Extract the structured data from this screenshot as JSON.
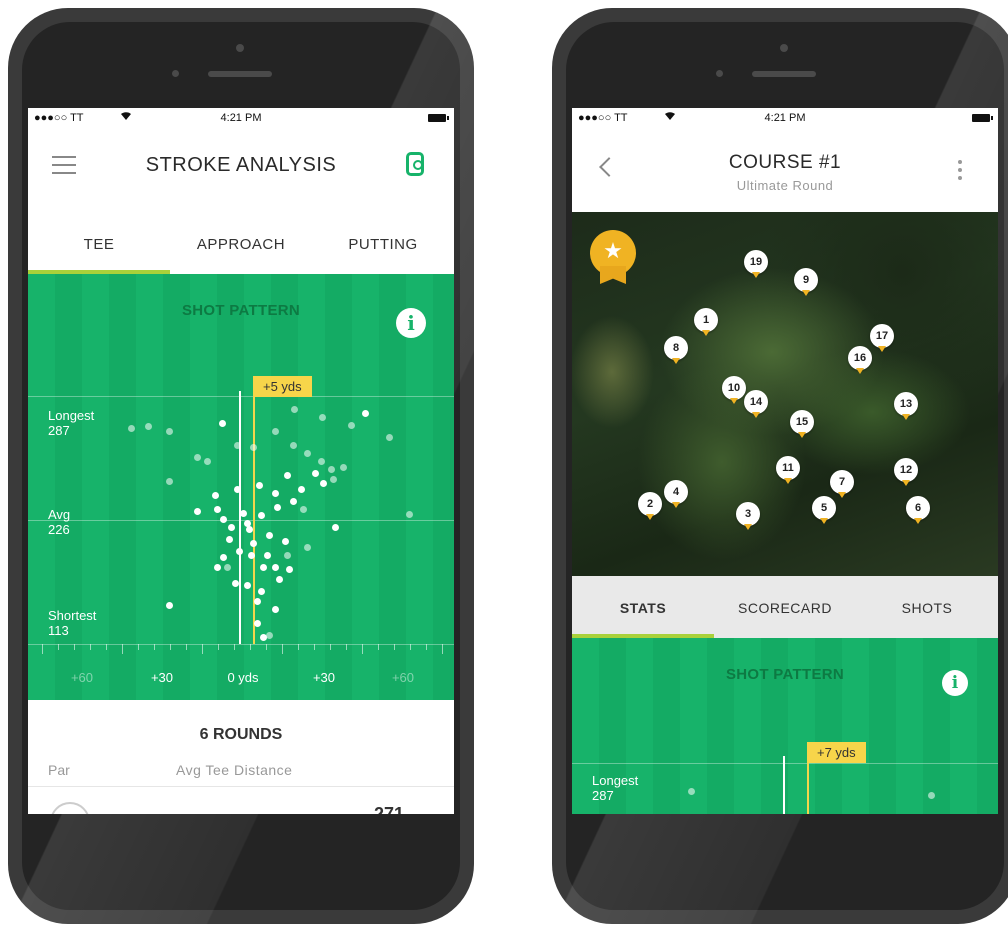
{
  "status_bar": {
    "carrier": "●●●○○ TT",
    "time": "4:21 PM"
  },
  "left": {
    "header": {
      "title": "STROKE ANALYSIS"
    },
    "tabs": [
      {
        "label": "TEE",
        "active": true
      },
      {
        "label": "APPROACH",
        "active": false
      },
      {
        "label": "PUTTING",
        "active": false
      }
    ],
    "shot_pattern": {
      "title": "SHOT PATTERN",
      "info_glyph": "i",
      "tag": "+5 yds",
      "rows": [
        {
          "name": "Longest",
          "value": "287"
        },
        {
          "name": "Avg",
          "value": "226"
        },
        {
          "name": "Shortest",
          "value": "113"
        }
      ],
      "axis": [
        "+60",
        "+30",
        "0 yds",
        "+30",
        "+60"
      ]
    },
    "summary": {
      "rounds": "6 ROUNDS",
      "par_label": "Par",
      "avg_label": "Avg Tee Distance",
      "value": "271"
    }
  },
  "right": {
    "header": {
      "title": "COURSE #1",
      "subtitle": "Ultimate Round"
    },
    "map_pins": [
      "19",
      "9",
      "1",
      "8",
      "17",
      "16",
      "10",
      "14",
      "13",
      "15",
      "11",
      "7",
      "12",
      "4",
      "2",
      "3",
      "5",
      "6"
    ],
    "tabs": [
      {
        "label": "STATS",
        "active": true
      },
      {
        "label": "SCORECARD",
        "active": false
      },
      {
        "label": "SHOTS",
        "active": false
      }
    ],
    "shot_pattern": {
      "title": "SHOT PATTERN",
      "info_glyph": "i",
      "tag": "+7 yds",
      "row": {
        "name": "Longest",
        "value": "287"
      }
    }
  },
  "colors": {
    "green": "#17b36a",
    "accent_lime": "#a9d13a",
    "tag_yellow": "#f7d54a",
    "pin_orange": "#f0b323"
  },
  "icons": [
    "menu-icon",
    "watch-icon",
    "info-icon",
    "back-icon",
    "more-icon",
    "star-badge-icon",
    "wifi-icon",
    "battery-icon"
  ]
}
